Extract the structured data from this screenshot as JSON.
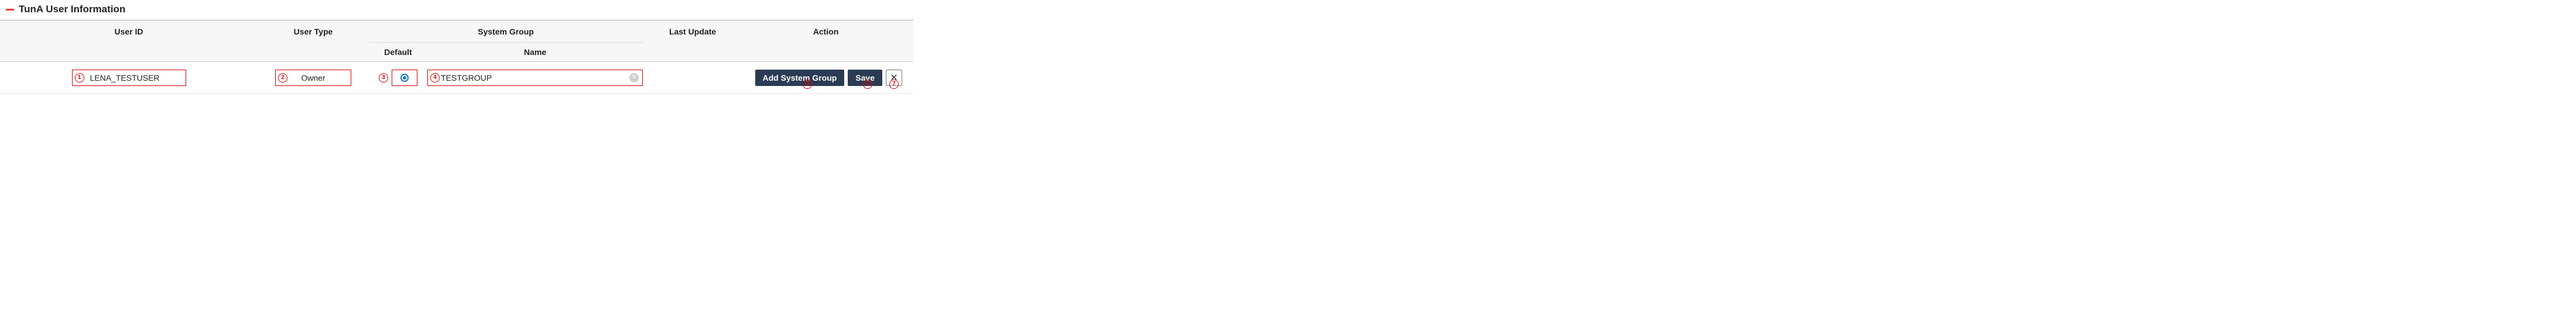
{
  "section": {
    "title": "TunA User Information"
  },
  "headers": {
    "user_id": "User ID",
    "user_type": "User Type",
    "system_group": "System Group",
    "default": "Default",
    "name": "Name",
    "last_update": "Last Update",
    "action": "Action"
  },
  "row": {
    "user_id": "LENA_TESTUSER",
    "user_type": "Owner",
    "default_selected": true,
    "group_name": "TESTGROUP",
    "last_update": ""
  },
  "actions": {
    "add_system_group": "Add System Group",
    "save": "Save"
  },
  "markers": {
    "m1": "1",
    "m2": "2",
    "m3": "3",
    "m4": "4",
    "m5": "5",
    "m6": "6",
    "m7": "7"
  }
}
